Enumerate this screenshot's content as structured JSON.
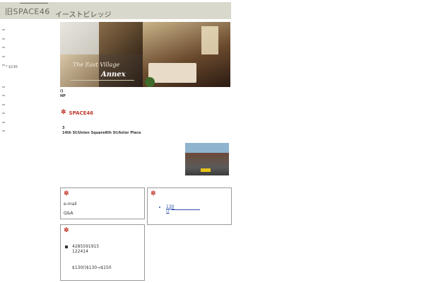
{
  "header": {
    "logo_text": "旧SPACE46",
    "title": "イーストビレッジ"
  },
  "nav": {
    "items": [
      "",
      "",
      "",
      "",
      "",
      "",
      "",
      "",
      "",
      "",
      ""
    ]
  },
  "sidebar_price": "* $130",
  "hero": {
    "caption_line1": "The East Village",
    "caption_line2": "Annex"
  },
  "info": {
    "line1": "()",
    "line2": "HP"
  },
  "section": {
    "title": "SPACE46"
  },
  "address": {
    "line1": "3",
    "line2": "14th St/Union Square8th St/Astor Place"
  },
  "box_contact": {
    "email_label": "e-mail",
    "qa_label": "Q&A"
  },
  "box_links": {
    "link1": "130",
    "link2": "()"
  },
  "box_phone": {
    "phone1": "4285591915",
    "phone2": "122414",
    "price": "$130()$130→$150"
  },
  "colors": {
    "accent": "#c0392b",
    "header_bg": "#d9d8cc",
    "link": "#2b4fa8",
    "border": "#9a9a9a"
  },
  "icons": {
    "section": "flower-icon",
    "bullet": "bullet-icon"
  }
}
